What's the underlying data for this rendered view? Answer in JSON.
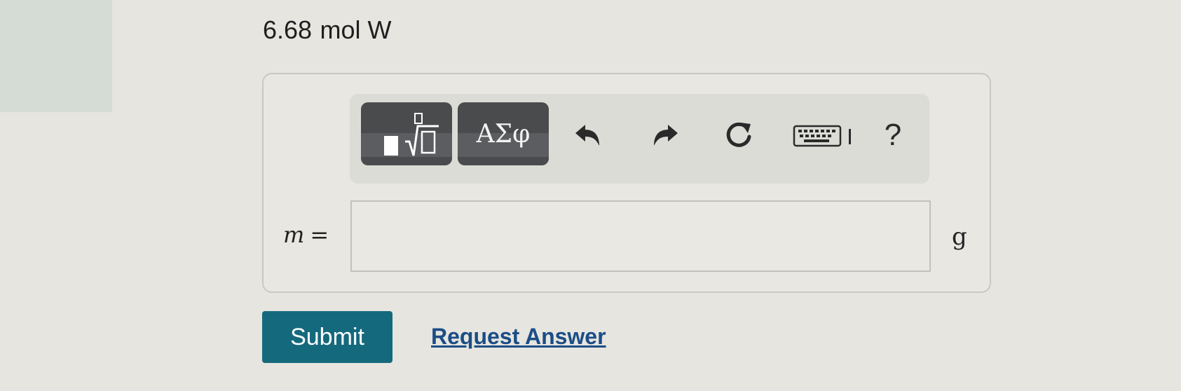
{
  "question": {
    "quantity": "6.68",
    "unit": "mol W"
  },
  "toolbar": {
    "template_button": {
      "icon": "fraction-root-template-icon"
    },
    "greek_button": {
      "label": "ΑΣφ"
    },
    "undo": {
      "icon": "undo-icon"
    },
    "redo": {
      "icon": "redo-icon"
    },
    "reset": {
      "icon": "reset-icon"
    },
    "keyboard": {
      "icon": "keyboard-icon"
    },
    "help": {
      "label": "?"
    }
  },
  "answer": {
    "variable": "m",
    "equals": "=",
    "value": "",
    "unit": "g"
  },
  "actions": {
    "submit_label": "Submit",
    "request_label": "Request Answer"
  },
  "colors": {
    "submit_bg": "#15697d",
    "link": "#1b4d86",
    "toolbar_button_bg": "#4a4b4d"
  }
}
